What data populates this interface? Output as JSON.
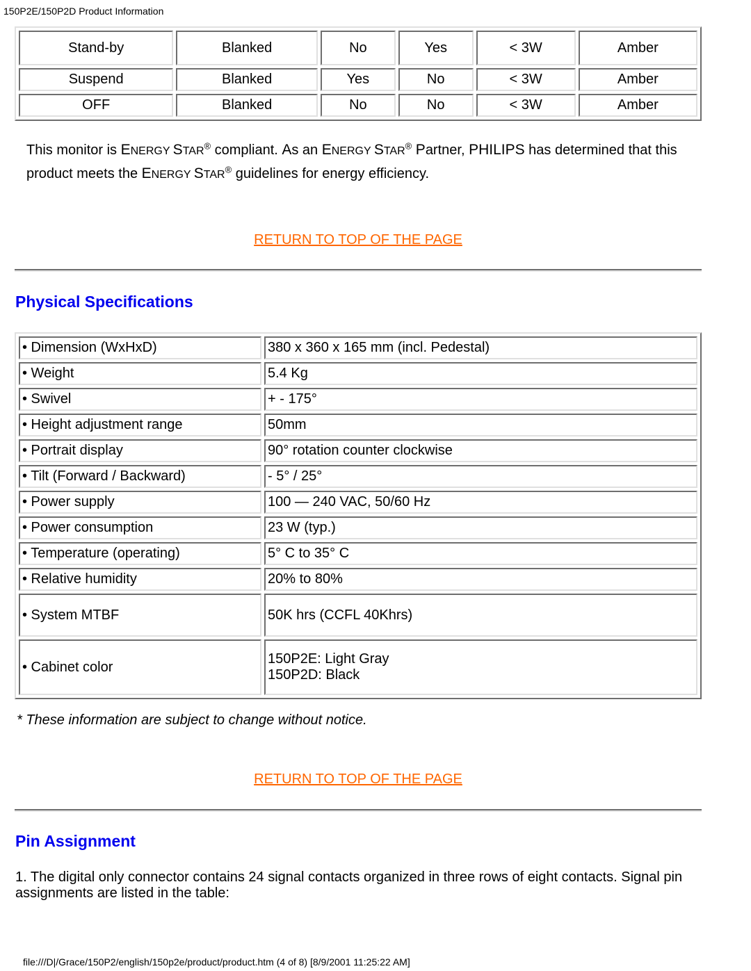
{
  "header": {
    "title": "150P2E/150P2D Product Information"
  },
  "power_table": {
    "rows": [
      [
        "Stand-by",
        "Blanked",
        "No",
        "Yes",
        "< 3W",
        "Amber"
      ],
      [
        "Suspend",
        "Blanked",
        "Yes",
        "No",
        "< 3W",
        "Amber"
      ],
      [
        "OFF",
        "Blanked",
        "No",
        "No",
        "< 3W",
        "Amber"
      ]
    ]
  },
  "energy": {
    "p1": "This monitor is ",
    "es_E": "E",
    "es_NERGY": "NERGY ",
    "es_S": "S",
    "es_TAR": "TAR",
    "reg": "®",
    "p2": " compliant. ",
    "as_A": "A",
    "as_s": "s an ",
    "p3": " ",
    "partner_P": "P",
    "partner_rest": "artner, ",
    "philips": "PHILIPS",
    "p4": " has determined that this product meets the ",
    "p5": " guidelines for energy efficiency."
  },
  "links": {
    "return_to_top": "RETURN TO TOP OF THE PAGE"
  },
  "physical": {
    "title": "Physical Specifications",
    "rows": [
      {
        "label": "• Dimension (WxHxD)",
        "value": "380 x 360 x 165 mm (incl. Pedestal)"
      },
      {
        "label": "• Weight",
        "value": "5.4 Kg"
      },
      {
        "label": "• Swivel",
        "value": "+ - 175°"
      },
      {
        "label": "• Height adjustment range",
        "value": "50mm"
      },
      {
        "label": "• Portrait display",
        "value": "90° rotation counter clockwise"
      },
      {
        "label": "• Tilt (Forward / Backward)",
        "value": "- 5° / 25°"
      },
      {
        "label": "• Power supply",
        "value": "100 — 240 VAC, 50/60 Hz"
      },
      {
        "label": "• Power consumption",
        "value": "23 W (typ.)"
      },
      {
        "label": "• Temperature (operating)",
        "value": "5° C to 35° C"
      },
      {
        "label": "• Relative humidity",
        "value": "20% to 80%"
      },
      {
        "label": "• System MTBF",
        "value": "50K hrs (CCFL 40Khrs)"
      },
      {
        "label": "• Cabinet color",
        "value_line1": "150P2E: Light Gray",
        "value_line2": "150P2D: Black"
      }
    ],
    "notice": "* These information are subject to change without notice."
  },
  "pin": {
    "title": "Pin Assignment",
    "text": "1. The digital only connector contains 24 signal contacts organized in three rows of eight contacts. Signal pin assignments are listed in the table:"
  },
  "footer": {
    "text": "file:///D|/Grace/150P2/english/150p2e/product/product.htm (4 of 8) [8/9/2001 11:25:22 AM]"
  }
}
